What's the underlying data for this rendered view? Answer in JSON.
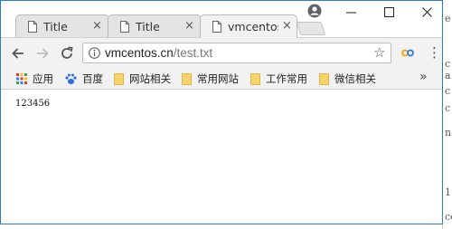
{
  "browser": {
    "tabs": [
      {
        "title": "Title",
        "active": false
      },
      {
        "title": "Title",
        "active": false
      },
      {
        "title": "vmcentos",
        "active": true
      }
    ],
    "close_glyph": "×"
  },
  "window_controls": {
    "minimize": "—",
    "maximize": "☐",
    "close": "✕"
  },
  "toolbar": {
    "url_host": "vmcentos.cn",
    "url_path": "/test.txt",
    "star_glyph": "☆",
    "menu_glyph": "⋮",
    "extension_glyph": "∞",
    "more_bookmarks_glyph": "»"
  },
  "bookmarks": [
    {
      "label": "应用",
      "icon": "apps-grid-icon"
    },
    {
      "label": "百度",
      "icon": "baidu-paw-icon"
    },
    {
      "label": "网站相关",
      "icon": "folder-icon"
    },
    {
      "label": "常用网站",
      "icon": "folder-icon"
    },
    {
      "label": "工作常用",
      "icon": "folder-icon"
    },
    {
      "label": "微信相关",
      "icon": "folder-icon"
    }
  ],
  "page": {
    "content": "123456"
  },
  "desktop_sliver": {
    "fragments": [
      "e",
      "c",
      "a",
      "c",
      "c",
      "n",
      "1",
      "ce"
    ]
  },
  "colors": {
    "window_border": "#2d7cc9",
    "toolbar_bg": "#f2f2f2",
    "folder": "#f6d36b"
  }
}
